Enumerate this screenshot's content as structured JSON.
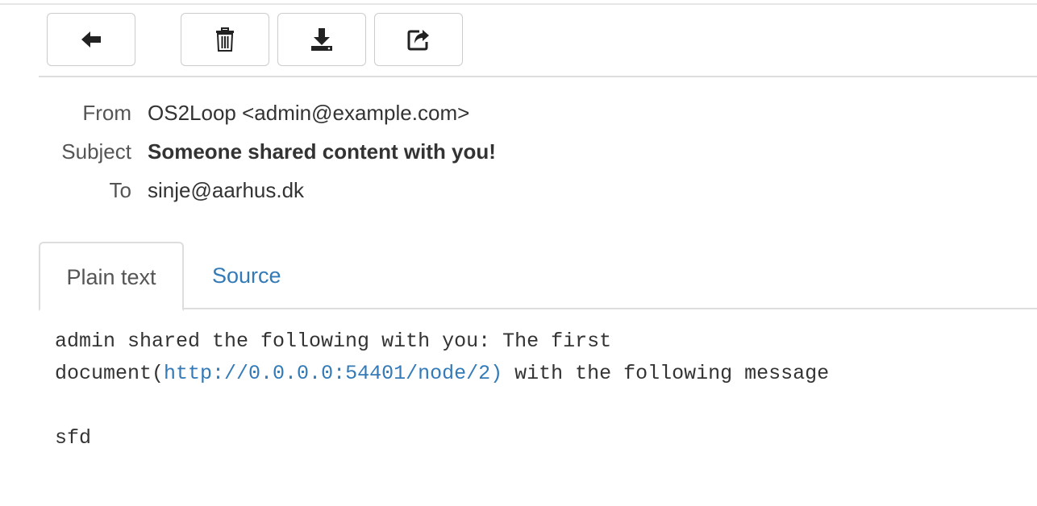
{
  "toolbar": {
    "buttons": [
      {
        "icon": "arrow-left-icon"
      },
      {
        "icon": "trash-icon"
      },
      {
        "icon": "download-icon"
      },
      {
        "icon": "share-icon"
      }
    ]
  },
  "headers": {
    "from_label": "From",
    "from_value": "OS2Loop <admin@example.com>",
    "subject_label": "Subject",
    "subject_value": "Someone shared content with you!",
    "to_label": "To",
    "to_value": "sinje@aarhus.dk"
  },
  "tabs": [
    {
      "label": "Plain text",
      "active": true
    },
    {
      "label": "Source",
      "active": false
    }
  ],
  "message": {
    "line1": "admin shared the following with you: The first",
    "line2_prefix": "document(",
    "link": "http://0.0.0.0:54401/node/2)",
    "line2_suffix": " with the following message",
    "line4": "sfd"
  },
  "colors": {
    "link": "#337ab7",
    "border": "#cccccc",
    "text": "#333333"
  }
}
